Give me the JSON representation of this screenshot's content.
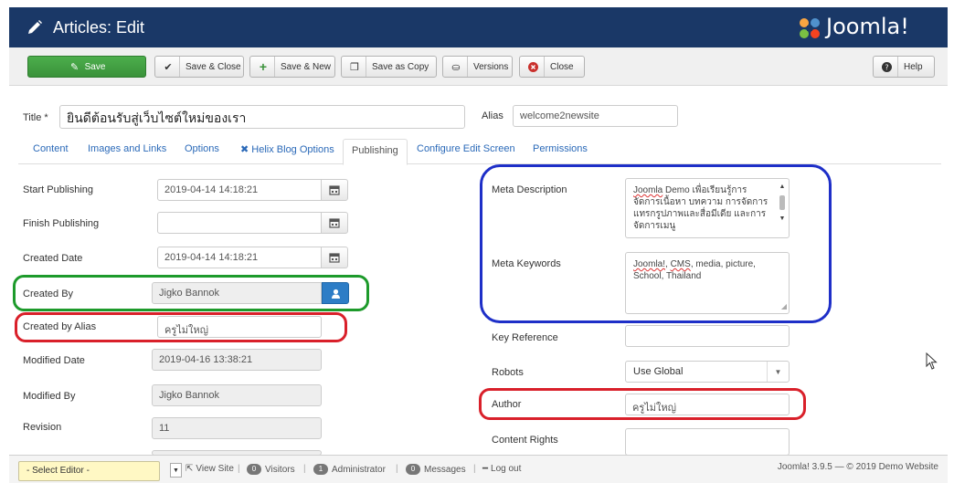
{
  "header": {
    "title": "Articles: Edit",
    "brand": "Joomla!"
  },
  "toolbar": {
    "save": "Save",
    "save_close": "Save & Close",
    "save_new": "Save & New",
    "save_copy": "Save as Copy",
    "versions": "Versions",
    "close": "Close",
    "help": "Help"
  },
  "title_field": {
    "label": "Title *",
    "value": "ยินดีต้อนรับสู่เว็บไซต์ใหม่ของเรา"
  },
  "alias_field": {
    "label": "Alias",
    "value": "welcome2newsite"
  },
  "tabs": [
    "Content",
    "Images and Links",
    "Options",
    "Helix Blog Options",
    "Publishing",
    "Configure Edit Screen",
    "Permissions"
  ],
  "left": {
    "start_publishing": {
      "label": "Start Publishing",
      "value": "2019-04-14 14:18:21"
    },
    "finish_publishing": {
      "label": "Finish Publishing",
      "value": ""
    },
    "created_date": {
      "label": "Created Date",
      "value": "2019-04-14 14:18:21"
    },
    "created_by": {
      "label": "Created By",
      "value": "Jigko Bannok"
    },
    "created_by_alias": {
      "label": "Created by Alias",
      "value": "ครูไม่ใหญ่"
    },
    "modified_date": {
      "label": "Modified Date",
      "value": "2019-04-16 13:38:21"
    },
    "modified_by": {
      "label": "Modified By",
      "value": "Jigko Bannok"
    },
    "revision": {
      "label": "Revision",
      "value": "11"
    }
  },
  "right": {
    "meta_description": {
      "label": "Meta Description",
      "line1_a": "Joomla",
      "line1_b": " Demo เพื่อเรียนรู้การ",
      "line2": "จัดการเนื้อหา บทความ การจัดการ",
      "line3": "แทรกรูปภาพและสื่อมีเดีย และการ",
      "line4": "จัดการเมนู"
    },
    "meta_keywords": {
      "label": "Meta Keywords",
      "kw1": "Joomla!",
      "kw_sep1": ", ",
      "kw2": "CMS",
      "kw_rest": ", media, picture,",
      "line2": "School, Thailand"
    },
    "key_reference": {
      "label": "Key Reference",
      "value": ""
    },
    "robots": {
      "label": "Robots",
      "value": "Use Global"
    },
    "author": {
      "label": "Author",
      "value": "ครูไม่ใหญ่"
    },
    "content_rights": {
      "label": "Content Rights",
      "value": ""
    }
  },
  "statusbar": {
    "editor": "- Select Editor -",
    "view_site": "View Site",
    "visitors_count": "0",
    "visitors": "Visitors",
    "admin_count": "1",
    "administrator": "Administrator",
    "messages_count": "0",
    "messages": "Messages",
    "logout": "Log out",
    "footer": "Joomla! 3.9.5 — © 2019 Demo Website"
  },
  "colors": {
    "header_bg": "#1a3867",
    "save_green": "#3a923a",
    "highlight_green": "#1d9a2b",
    "highlight_red": "#d9202a",
    "highlight_blue": "#1e2fc8",
    "link_blue": "#2a69b8"
  }
}
